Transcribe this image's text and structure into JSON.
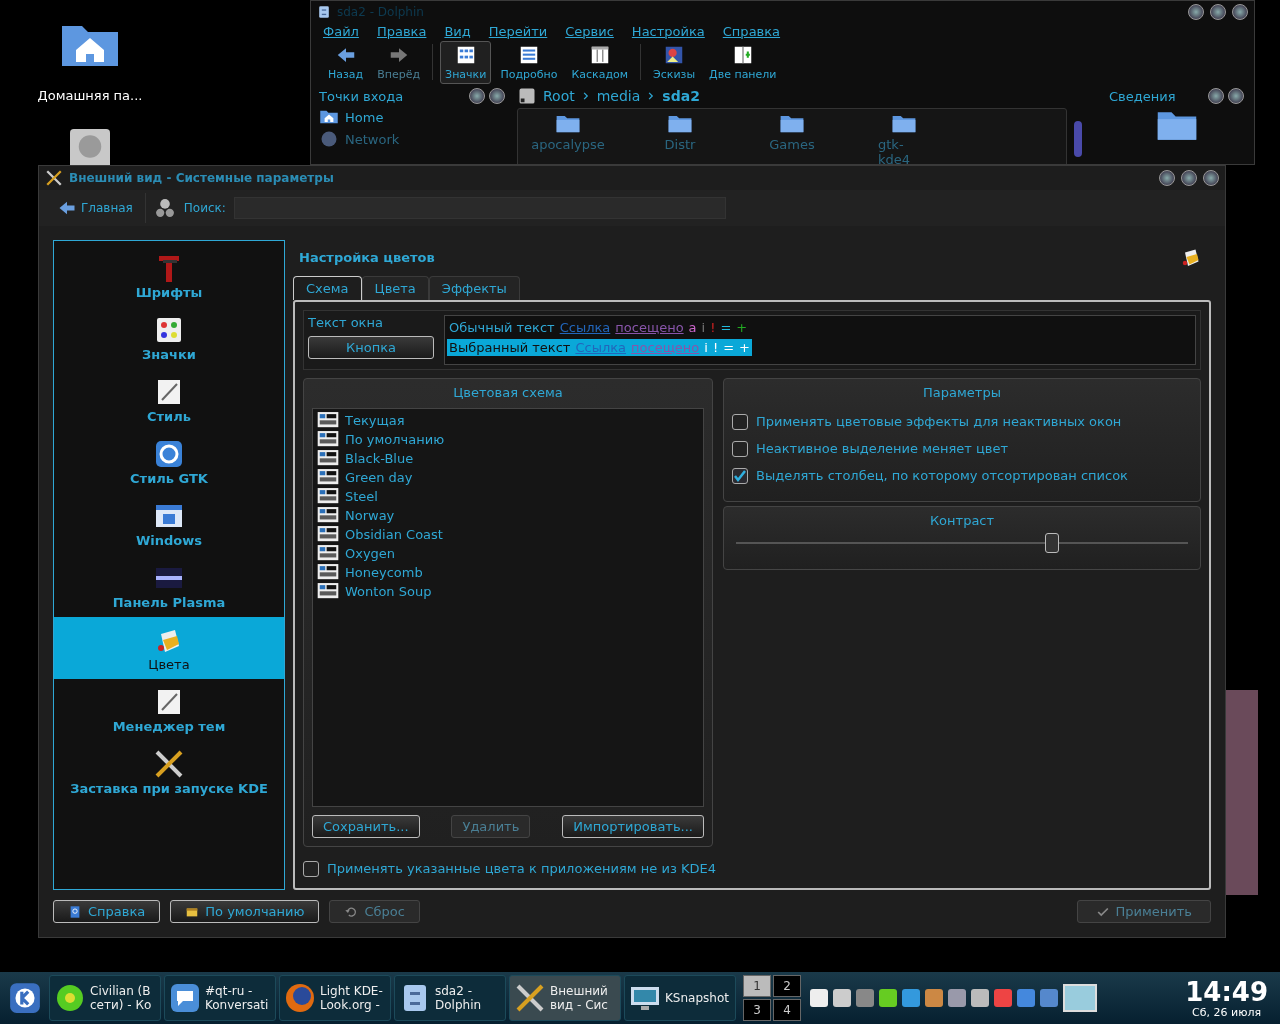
{
  "desktop_icons": [
    {
      "kind": "home",
      "label": "Домашняя па..."
    },
    {
      "kind": "drive"
    }
  ],
  "dolphin": {
    "title": "sda2 - Dolphin",
    "menu": [
      "Файл",
      "Правка",
      "Вид",
      "Перейти",
      "Сервис",
      "Настройка",
      "Справка"
    ],
    "toolbar": [
      {
        "kind": "back",
        "label": "Назад",
        "selected": false,
        "disabled": false
      },
      {
        "kind": "forward",
        "label": "Вперёд",
        "selected": false,
        "disabled": true
      },
      {
        "kind": "icons",
        "label": "Значки",
        "selected": true,
        "disabled": false
      },
      {
        "kind": "details",
        "label": "Подробно",
        "selected": false,
        "disabled": false
      },
      {
        "kind": "columns",
        "label": "Каскадом",
        "selected": false,
        "disabled": false
      },
      {
        "kind": "preview",
        "label": "Эскизы",
        "selected": false,
        "disabled": false
      },
      {
        "kind": "split",
        "label": "Две панели",
        "selected": false,
        "disabled": false
      }
    ],
    "places": {
      "title": "Точки входа",
      "items": [
        {
          "kind": "home",
          "label": "Home"
        },
        {
          "kind": "network",
          "label": "Network"
        }
      ]
    },
    "breadcrumb": [
      "Root",
      "media",
      "sda2"
    ],
    "files": [
      "apocalypse",
      "Distr",
      "Games",
      "gtk-kde4"
    ],
    "info": {
      "title": "Сведения"
    }
  },
  "settings": {
    "title": "Внешний вид - Системные параметры",
    "home_button": "Главная",
    "search_label": "Поиск:",
    "sidebar": [
      {
        "kind": "fonts",
        "label": "Шрифты",
        "selected": false
      },
      {
        "kind": "icons",
        "label": "Значки",
        "selected": false
      },
      {
        "kind": "style",
        "label": "Стиль",
        "selected": false
      },
      {
        "kind": "gtk",
        "label": "Стиль GTK",
        "selected": false
      },
      {
        "kind": "windows",
        "label": "Windows",
        "selected": false
      },
      {
        "kind": "panel",
        "label": "Панель Plasma",
        "selected": false
      },
      {
        "kind": "colors",
        "label": "Цвета",
        "selected": true
      },
      {
        "kind": "themes",
        "label": "Менеджер тем",
        "selected": false
      },
      {
        "kind": "splash",
        "label": "Заставка при запуске KDE",
        "selected": false
      }
    ],
    "page_title": "Настройка цветов",
    "tabs": [
      {
        "label": "Схема",
        "selected": true
      },
      {
        "label": "Цвета",
        "selected": false
      },
      {
        "label": "Эффекты",
        "selected": false
      }
    ],
    "preview": {
      "window_text": "Текст окна",
      "button": "Кнопка",
      "normal": [
        {
          "kind": "text",
          "text": "Обычный текст"
        },
        {
          "kind": "link",
          "text": "Ссылка"
        },
        {
          "kind": "visited",
          "text": "посещено"
        },
        {
          "kind": "active",
          "text": "а"
        },
        {
          "kind": "inactive",
          "text": "і"
        },
        {
          "kind": "negative",
          "text": "!"
        },
        {
          "kind": "neutral",
          "text": "="
        },
        {
          "kind": "positive",
          "text": "+"
        }
      ],
      "selected": [
        {
          "kind": "text",
          "text": "Выбранный текст"
        },
        {
          "kind": "link",
          "text": "Ссылка"
        },
        {
          "kind": "visited",
          "text": "посещено"
        },
        {
          "kind": "inactive",
          "text": "і"
        },
        {
          "kind": "negative",
          "text": "!"
        },
        {
          "kind": "neutral",
          "text": "="
        },
        {
          "kind": "positive",
          "text": "+"
        }
      ]
    },
    "scheme": {
      "title": "Цветовая схема",
      "items": [
        "Текущая",
        "По умолчанию",
        "Black-Blue",
        "Green day",
        "Steel",
        "Norway",
        "Obsidian Coast",
        "Oxygen",
        "Honeycomb",
        "Wonton Soup"
      ],
      "buttons": [
        {
          "label": "Сохранить...",
          "disabled": false
        },
        {
          "label": "Удалить",
          "disabled": true
        },
        {
          "label": "Импортировать...",
          "disabled": false
        }
      ]
    },
    "apply_other": {
      "label": "Применять указанные цвета к приложениям не из KDE4",
      "checked": false
    },
    "options": {
      "title": "Параметры",
      "items": [
        {
          "label": "Применять цветовые эффекты для неактивных окон",
          "checked": false
        },
        {
          "label": "Неактивное выделение меняет цвет",
          "checked": false
        },
        {
          "label": "Выделять столбец, по которому отсортирован список",
          "checked": true
        }
      ]
    },
    "contrast": {
      "title": "Контраст",
      "level": 0.7
    },
    "footer": [
      {
        "kind": "help",
        "label": "Справка",
        "disabled": false
      },
      {
        "kind": "defaults",
        "label": "По умолчанию",
        "disabled": false
      },
      {
        "kind": "reset",
        "label": "Сброс",
        "disabled": true
      }
    ],
    "apply": {
      "label": "Применить",
      "disabled": true
    }
  },
  "taskbar": {
    "tasks": [
      {
        "kind": "chat",
        "lines": [
          "Civilian (В",
          "сети) - Ко"
        ],
        "selected": false
      },
      {
        "kind": "irc",
        "lines": [
          "#qt-ru -",
          "Konversati"
        ],
        "selected": false
      },
      {
        "kind": "browser",
        "lines": [
          "Light KDE-",
          "Look.org -"
        ],
        "selected": false
      },
      {
        "kind": "files",
        "lines": [
          "sda2 -",
          "Dolphin"
        ],
        "selected": false
      },
      {
        "kind": "settings",
        "lines": [
          "Внешний",
          "вид - Сис"
        ],
        "selected": true
      },
      {
        "kind": "snapshot",
        "lines": [
          "KSnapshot"
        ],
        "selected": false
      }
    ],
    "pager": [
      {
        "label": "1",
        "selected": true
      },
      {
        "label": "2",
        "selected": false
      },
      {
        "label": "3",
        "selected": false
      },
      {
        "label": "4",
        "selected": false
      }
    ],
    "clock": {
      "time": "14:49",
      "date": "Сб, 26 июля"
    }
  }
}
